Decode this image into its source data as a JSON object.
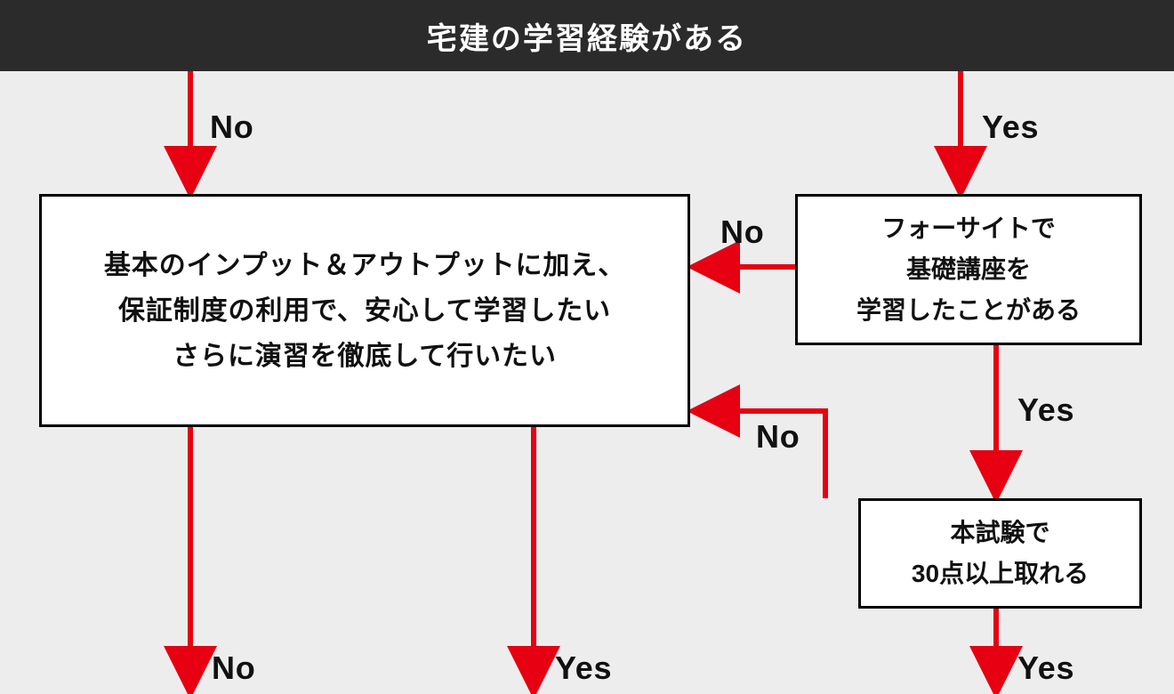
{
  "header": {
    "title": "宅建の学習経験がある"
  },
  "nodes": {
    "left_text": "基本のインプット＆アウトプットに加え、\n保証制度の利用で、安心して学習したい\nさらに演習を徹底して行いたい",
    "right1_text": "フォーサイトで\n基礎講座を\n学習したことがある",
    "right2_text": "本試験で\n30点以上取れる"
  },
  "labels": {
    "no": "No",
    "yes": "Yes"
  },
  "colors": {
    "arrow": "#e60012",
    "header_bg": "#2b2b2b",
    "canvas_bg": "#ededed"
  }
}
